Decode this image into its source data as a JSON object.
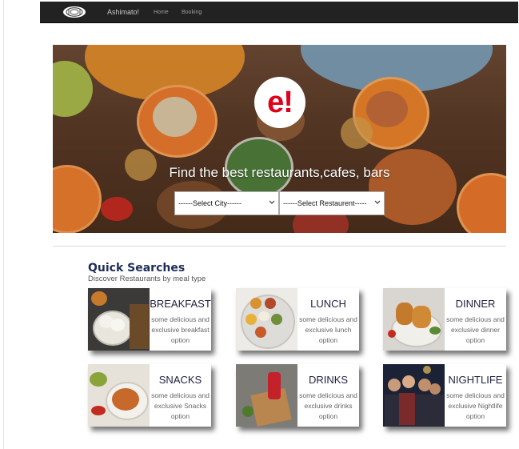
{
  "navbar": {
    "logo_icon": "plate-cutlery-icon",
    "brand": "Ashimato!",
    "links": [
      "Home",
      "Booking"
    ]
  },
  "hero": {
    "logo_text": "e!",
    "tagline": "Find the best restaurants,cafes, bars",
    "city_select": "------Select City------",
    "restaurant_select": "------Select Restaurent-----"
  },
  "quick": {
    "title": "Quick Searches",
    "subtitle": "Discover Restaurants by meal type",
    "cards": [
      {
        "title": "BREAKFAST",
        "desc": "some delicious and exclusive breakfast option"
      },
      {
        "title": "LUNCH",
        "desc": "some delicious and exclusive lunch option"
      },
      {
        "title": "DINNER",
        "desc": "some delicious and exclusive dinner option"
      },
      {
        "title": "SNACKS",
        "desc": "some delicious and exclusive Snacks option"
      },
      {
        "title": "DRINKS",
        "desc": "some delicious and exclusive drinks option"
      },
      {
        "title": "NIGHTLIFE",
        "desc": "some delicious and exclusive Nightlife option"
      }
    ]
  },
  "colors": {
    "navbar_bg": "#222222",
    "brand_red": "#e0001b",
    "heading_navy": "#1f2d5a"
  }
}
